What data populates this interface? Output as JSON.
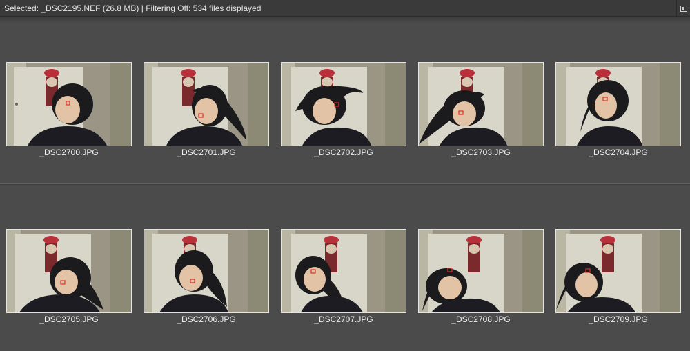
{
  "status": {
    "text": "Selected: _DSC2195.NEF (26.8 MB) | Filtering Off: 534 files displayed"
  },
  "corner_button_icon": "panel-toggle-icon",
  "colors": {
    "background": "#4b4b4b",
    "status_bar": "#3a3a3a",
    "focus_marker": "#e0302a"
  },
  "rows": [
    {
      "items": [
        {
          "filename": "_DSC2700.JPG"
        },
        {
          "filename": "_DSC2701.JPG"
        },
        {
          "filename": "_DSC2702.JPG"
        },
        {
          "filename": "_DSC2703.JPG"
        },
        {
          "filename": "_DSC2704.JPG"
        }
      ]
    },
    {
      "items": [
        {
          "filename": "_DSC2705.JPG"
        },
        {
          "filename": "_DSC2706.JPG"
        },
        {
          "filename": "_DSC2707.JPG"
        },
        {
          "filename": "_DSC2708.JPG"
        },
        {
          "filename": "_DSC2709.JPG"
        }
      ]
    }
  ]
}
